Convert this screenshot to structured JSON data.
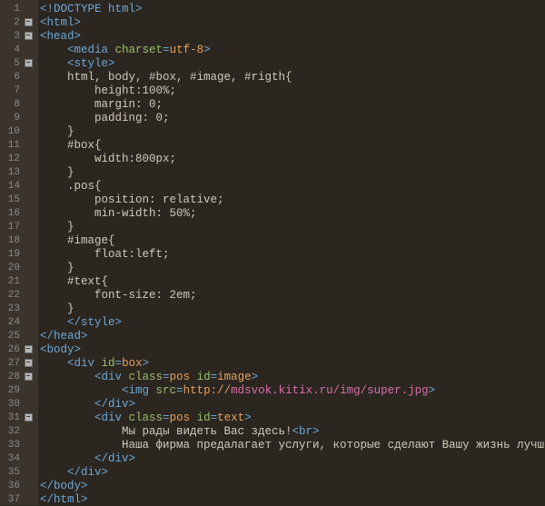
{
  "lines": [
    {
      "num": 1,
      "fold": null,
      "indent": 0,
      "segs": [
        [
          "tag",
          "<!DOCTYPE html>"
        ]
      ]
    },
    {
      "num": 2,
      "fold": "open",
      "indent": 0,
      "segs": [
        [
          "tag",
          "<html>"
        ]
      ]
    },
    {
      "num": 3,
      "fold": "open",
      "indent": 0,
      "segs": [
        [
          "tag",
          "<head>"
        ]
      ]
    },
    {
      "num": 4,
      "fold": null,
      "indent": 1,
      "segs": [
        [
          "tag",
          "<media "
        ],
        [
          "attr",
          "charset"
        ],
        [
          "tag",
          "="
        ],
        [
          "val",
          "utf-8"
        ],
        [
          "tag",
          ">"
        ]
      ]
    },
    {
      "num": 5,
      "fold": "open",
      "indent": 1,
      "segs": [
        [
          "tag",
          "<style>"
        ]
      ]
    },
    {
      "num": 6,
      "fold": null,
      "indent": 1,
      "segs": [
        [
          "css",
          "html, body, #box, #image, #rigth{"
        ]
      ]
    },
    {
      "num": 7,
      "fold": null,
      "indent": 2,
      "segs": [
        [
          "css",
          "height:100%;"
        ]
      ]
    },
    {
      "num": 8,
      "fold": null,
      "indent": 2,
      "segs": [
        [
          "css",
          "margin: 0;"
        ]
      ]
    },
    {
      "num": 9,
      "fold": null,
      "indent": 2,
      "segs": [
        [
          "css",
          "padding: 0;"
        ]
      ]
    },
    {
      "num": 10,
      "fold": null,
      "indent": 1,
      "segs": [
        [
          "css",
          "}"
        ]
      ]
    },
    {
      "num": 11,
      "fold": null,
      "indent": 1,
      "segs": [
        [
          "css",
          "#box{"
        ]
      ]
    },
    {
      "num": 12,
      "fold": null,
      "indent": 2,
      "segs": [
        [
          "css",
          "width:800px;"
        ]
      ]
    },
    {
      "num": 13,
      "fold": null,
      "indent": 1,
      "segs": [
        [
          "css",
          "}"
        ]
      ]
    },
    {
      "num": 14,
      "fold": null,
      "indent": 1,
      "segs": [
        [
          "css",
          ".pos{"
        ]
      ]
    },
    {
      "num": 15,
      "fold": null,
      "indent": 2,
      "segs": [
        [
          "css",
          "position: relative;"
        ]
      ]
    },
    {
      "num": 16,
      "fold": null,
      "indent": 2,
      "segs": [
        [
          "css",
          "min-width: 50%;"
        ]
      ]
    },
    {
      "num": 17,
      "fold": null,
      "indent": 1,
      "segs": [
        [
          "css",
          "}"
        ]
      ]
    },
    {
      "num": 18,
      "fold": null,
      "indent": 1,
      "segs": [
        [
          "css",
          "#image{"
        ]
      ]
    },
    {
      "num": 19,
      "fold": null,
      "indent": 2,
      "segs": [
        [
          "css",
          "float:left;"
        ]
      ]
    },
    {
      "num": 20,
      "fold": null,
      "indent": 1,
      "segs": [
        [
          "css",
          "}"
        ]
      ]
    },
    {
      "num": 21,
      "fold": null,
      "indent": 1,
      "segs": [
        [
          "css",
          "#text{"
        ]
      ]
    },
    {
      "num": 22,
      "fold": null,
      "indent": 2,
      "segs": [
        [
          "css",
          "font-size: 2em;"
        ]
      ]
    },
    {
      "num": 23,
      "fold": null,
      "indent": 1,
      "segs": [
        [
          "css",
          "}"
        ]
      ]
    },
    {
      "num": 24,
      "fold": null,
      "indent": 1,
      "segs": [
        [
          "tag",
          "</style>"
        ]
      ]
    },
    {
      "num": 25,
      "fold": null,
      "indent": 0,
      "segs": [
        [
          "tag",
          "</head>"
        ]
      ]
    },
    {
      "num": 26,
      "fold": "open",
      "indent": 0,
      "segs": [
        [
          "tag",
          "<body>"
        ]
      ]
    },
    {
      "num": 27,
      "fold": "open",
      "indent": 1,
      "segs": [
        [
          "tag",
          "<div "
        ],
        [
          "attr",
          "id"
        ],
        [
          "tag",
          "="
        ],
        [
          "val",
          "box"
        ],
        [
          "tag",
          ">"
        ]
      ]
    },
    {
      "num": 28,
      "fold": "open",
      "indent": 2,
      "segs": [
        [
          "tag",
          "<div "
        ],
        [
          "attr",
          "class"
        ],
        [
          "tag",
          "="
        ],
        [
          "val",
          "pos"
        ],
        [
          "tag",
          " "
        ],
        [
          "attr",
          "id"
        ],
        [
          "tag",
          "="
        ],
        [
          "val",
          "image"
        ],
        [
          "tag",
          ">"
        ]
      ]
    },
    {
      "num": 29,
      "fold": null,
      "indent": 3,
      "segs": [
        [
          "tag",
          "<img "
        ],
        [
          "attr",
          "src"
        ],
        [
          "tag",
          "="
        ],
        [
          "val",
          "http://"
        ],
        [
          "url",
          "mdsvok.kitix.ru/img/super.jpg"
        ],
        [
          "tag",
          ">"
        ]
      ]
    },
    {
      "num": 30,
      "fold": null,
      "indent": 2,
      "segs": [
        [
          "tag",
          "</div>"
        ]
      ]
    },
    {
      "num": 31,
      "fold": "open",
      "indent": 2,
      "segs": [
        [
          "tag",
          "<div "
        ],
        [
          "attr",
          "class"
        ],
        [
          "tag",
          "="
        ],
        [
          "val",
          "pos"
        ],
        [
          "tag",
          " "
        ],
        [
          "attr",
          "id"
        ],
        [
          "tag",
          "="
        ],
        [
          "val",
          "text"
        ],
        [
          "tag",
          ">"
        ]
      ]
    },
    {
      "num": 32,
      "fold": null,
      "indent": 3,
      "segs": [
        [
          "text",
          "Мы рады видеть Вас здесь!"
        ],
        [
          "tag",
          "<br>"
        ]
      ]
    },
    {
      "num": 33,
      "fold": null,
      "indent": 3,
      "segs": [
        [
          "text",
          "Наша фирма предалагает услуги, которые сделают Вашу жизнь лучше!"
        ]
      ]
    },
    {
      "num": 34,
      "fold": null,
      "indent": 2,
      "segs": [
        [
          "tag",
          "</div>"
        ]
      ]
    },
    {
      "num": 35,
      "fold": null,
      "indent": 1,
      "segs": [
        [
          "tag",
          "</div>"
        ]
      ]
    },
    {
      "num": 36,
      "fold": null,
      "indent": 0,
      "segs": [
        [
          "tag",
          "</body>"
        ]
      ]
    },
    {
      "num": 37,
      "fold": null,
      "indent": 0,
      "segs": [
        [
          "tag",
          "</html>"
        ]
      ]
    }
  ],
  "indentString": "    ",
  "foldGlyph": "−",
  "tokenClass": {
    "tag": "t-tag",
    "attr": "t-attr",
    "val": "t-val",
    "text": "t-text",
    "css": "t-css",
    "url": "t-url",
    "punct": "t-punct"
  }
}
